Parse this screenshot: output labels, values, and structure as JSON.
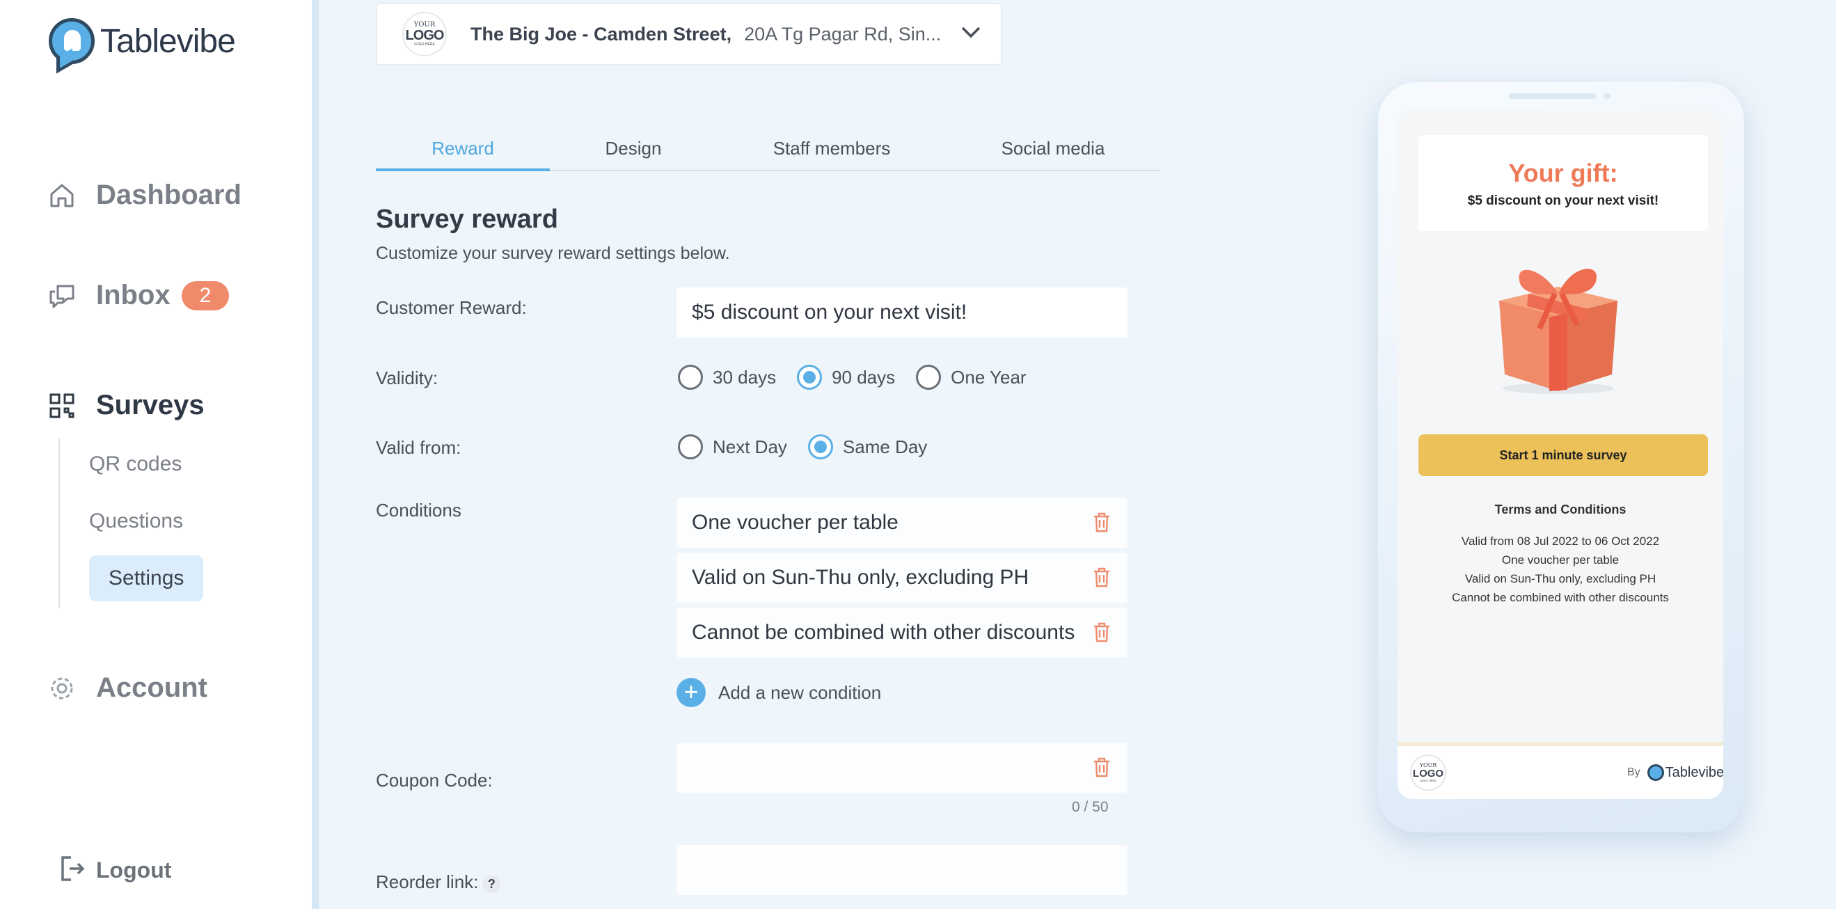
{
  "app": {
    "name": "Tablevibe"
  },
  "sidebar": {
    "nav": [
      {
        "label": "Dashboard",
        "icon": "home-icon"
      },
      {
        "label": "Inbox",
        "icon": "inbox-icon",
        "badge": "2"
      },
      {
        "label": "Surveys",
        "icon": "qr-icon"
      },
      {
        "label": "Account",
        "icon": "gear-icon"
      }
    ],
    "subnav": [
      {
        "label": "QR codes"
      },
      {
        "label": "Questions"
      },
      {
        "label": "Settings",
        "active": true
      }
    ],
    "logout_label": "Logout"
  },
  "venue": {
    "logo": {
      "line1": "YOUR",
      "line2": "LOGO",
      "line3": "GOES HERE"
    },
    "name": "The Big Joe - Camden Street,",
    "address": "20A Tg Pagar Rd, Sin..."
  },
  "tabs": [
    {
      "label": "Reward",
      "active": true
    },
    {
      "label": "Design"
    },
    {
      "label": "Staff members"
    },
    {
      "label": "Social media"
    }
  ],
  "form": {
    "title": "Survey reward",
    "subtitle": "Customize your survey reward settings below.",
    "customer_reward": {
      "label": "Customer Reward:",
      "value": "$5 discount on your next visit!"
    },
    "validity": {
      "label": "Validity:",
      "options": [
        "30 days",
        "90 days",
        "One Year"
      ],
      "selected": "90 days"
    },
    "valid_from": {
      "label": "Valid from:",
      "options": [
        "Next Day",
        "Same Day"
      ],
      "selected": "Same Day"
    },
    "conditions": {
      "label": "Conditions",
      "items": [
        "One voucher per table",
        "Valid on Sun-Thu only, excluding PH",
        "Cannot be combined with other discounts"
      ],
      "add_label": "Add a new condition"
    },
    "coupon_code": {
      "label": "Coupon Code:",
      "value": "",
      "counter": "0 / 50"
    },
    "reorder_link": {
      "label": "Reorder link:",
      "help": "?"
    }
  },
  "preview": {
    "gift_title": "Your gift:",
    "gift_subtitle": "$5 discount on your next visit!",
    "start_button": "Start 1 minute survey",
    "terms_title": "Terms and Conditions",
    "terms_lines": [
      "Valid from 08 Jul 2022 to 06 Oct 2022",
      "One voucher per table",
      "Valid on Sun-Thu only, excluding PH",
      "Cannot be combined with other discounts"
    ],
    "footer_by": "By",
    "footer_brand": "Tablevibe"
  },
  "colors": {
    "accent": "#5ab0e6",
    "badge": "#f08a6b",
    "gift": "#ee7a57",
    "button": "#ecc15a"
  }
}
